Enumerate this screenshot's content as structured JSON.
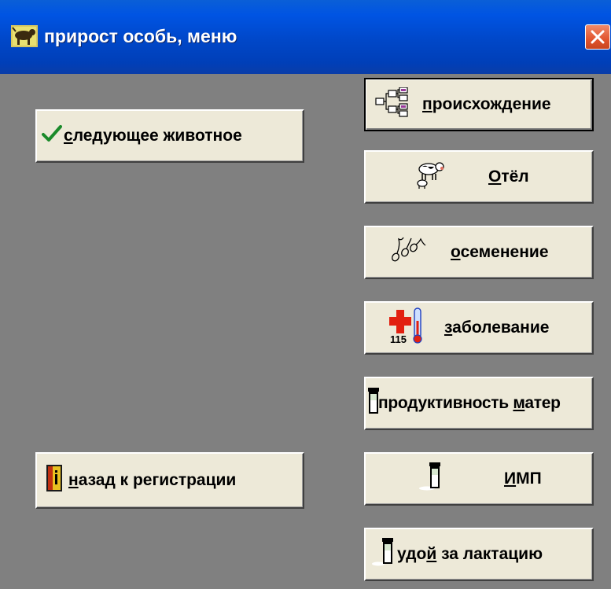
{
  "window": {
    "title": "прирост особь, меню",
    "icon": "cow-icon",
    "close_icon": "close-icon"
  },
  "buttons": {
    "next_animal": {
      "pre": "",
      "accel": "с",
      "post": "ледующее животное",
      "icon": "checkmark-icon"
    },
    "back_to_registration": {
      "pre": " ",
      "accel": "н",
      "post": "азад к регистрации",
      "icon": "info-door-icon"
    },
    "origin": {
      "pre": "",
      "accel": "п",
      "post": "роисхождение",
      "icon": "tree-icon"
    },
    "calving": {
      "pre": "",
      "accel": "О",
      "post": "тёл",
      "icon": "cow-calf-icon"
    },
    "insemination": {
      "pre": "",
      "accel": "о",
      "post": "семенение",
      "icon": "sperm-icon"
    },
    "disease": {
      "pre": "",
      "accel": "з",
      "post": "аболевание",
      "icon": "medical-thermometer-icon"
    },
    "mother_productivity": {
      "pre": "продуктивность ",
      "accel": "м",
      "post": "атер",
      "icon": "milk-bottle-icon"
    },
    "imp": {
      "pre": "",
      "accel": "И",
      "post": "МП",
      "icon": "milk-bottle-icon"
    },
    "lactation_yield": {
      "pre": "удо",
      "accel": "й",
      "post": " за лактацию",
      "icon": "milk-bottle-icon"
    }
  },
  "colors": {
    "titlebar": "#0054e3",
    "window_bg": "#808080",
    "button_face": "#ede9d8",
    "close_button": "#e2552e"
  }
}
